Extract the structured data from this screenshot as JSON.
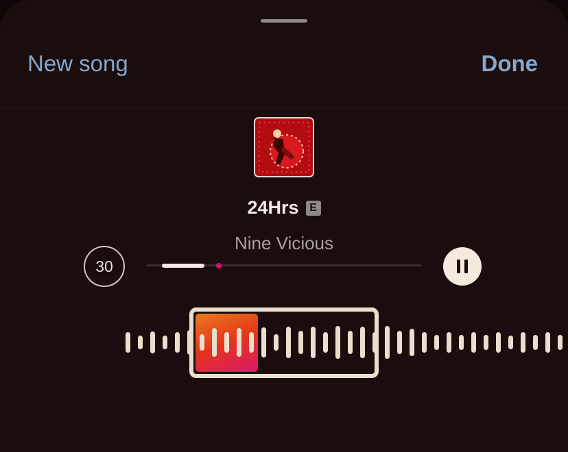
{
  "header": {
    "new_song_label": "New song",
    "done_label": "Done"
  },
  "track": {
    "title": "24Hrs",
    "explicit_badge": "E",
    "artist": "Nine Vicious",
    "album_art_colors": [
      "#b30d10",
      "#e6262a",
      "#6b0a0a",
      "#f1c9b8"
    ]
  },
  "player": {
    "clip_duration": "30",
    "playback_state": "playing",
    "progress_fraction": 0.26
  },
  "colors": {
    "accent_link": "#85a7ce",
    "background": "#1b0d0d",
    "waveform": "#eadfcf",
    "selection_gradient": [
      "#ea7a1e",
      "#e5351a",
      "#d81a6c"
    ],
    "progress_dot": "#d3107a"
  },
  "icons": {
    "pause": "pause-icon",
    "explicit": "explicit-icon",
    "grabber": "sheet-grabber"
  }
}
